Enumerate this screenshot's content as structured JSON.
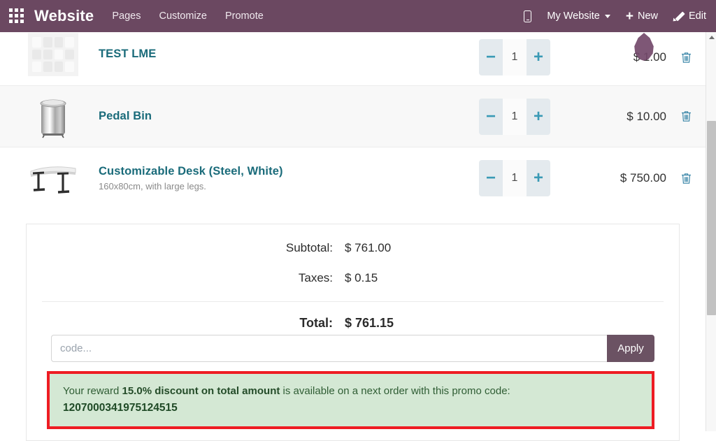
{
  "topbar": {
    "apps_icon": "apps-grid-icon",
    "brand": "Website",
    "menu": [
      {
        "label": "Pages"
      },
      {
        "label": "Customize"
      },
      {
        "label": "Promote"
      }
    ],
    "mobile_preview_icon": "mobile-phone-icon",
    "website_selector": "My Website",
    "new_label": "New",
    "new_icon": "plus-icon",
    "edit_label": "Edit",
    "edit_icon": "pencil-icon"
  },
  "cart": {
    "items": [
      {
        "name": "TEST LME",
        "description": "",
        "thumb": "placeholder-image",
        "quantity": "1",
        "price": "$ 1.00",
        "decrease_label": "−",
        "increase_label": "+",
        "delete_icon": "trash-icon"
      },
      {
        "name": "Pedal Bin",
        "description": "",
        "thumb": "pedal-bin-image",
        "quantity": "1",
        "price": "$ 10.00",
        "decrease_label": "−",
        "increase_label": "+",
        "delete_icon": "trash-icon"
      },
      {
        "name": "Customizable Desk (Steel, White)",
        "description": "160x80cm, with large legs.",
        "thumb": "desk-image",
        "quantity": "1",
        "price": "$ 750.00",
        "decrease_label": "−",
        "increase_label": "+",
        "delete_icon": "trash-icon"
      }
    ]
  },
  "summary": {
    "subtotal_label": "Subtotal:",
    "subtotal_value": "$ 761.00",
    "taxes_label": "Taxes:",
    "taxes_value": "$ 0.15",
    "total_label": "Total:",
    "total_value": "$ 761.15"
  },
  "promo": {
    "placeholder": "code...",
    "value": "",
    "apply_label": "Apply"
  },
  "reward": {
    "prefix": "Your reward ",
    "highlight": "15.0% discount on total amount",
    "suffix": " is available on a next order with this promo code:",
    "code": "1207000341975124515"
  },
  "colors": {
    "topbar": "#6b4861",
    "link": "#1a6b7a",
    "accent_teal": "#3a9ab5",
    "apply_button": "#6b5263",
    "alert_bg": "#d4e8d4",
    "alert_text": "#2f5d34",
    "highlight_outline": "#ee1c23",
    "cursor": "#73496a"
  },
  "scrollbar": {
    "up_arrow": "scroll-up-arrow"
  }
}
